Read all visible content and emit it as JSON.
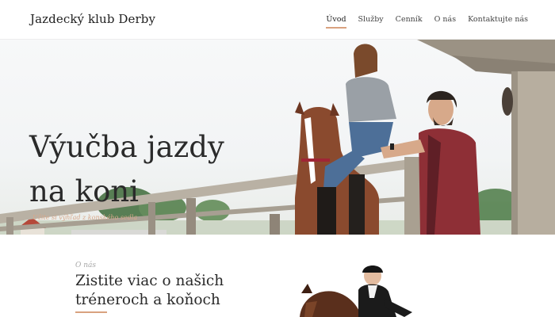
{
  "header": {
    "brand": "Jazdecký klub Derby",
    "nav": [
      {
        "label": "Úvod",
        "active": true
      },
      {
        "label": "Služby",
        "active": false
      },
      {
        "label": "Cenník",
        "active": false
      },
      {
        "label": "O nás",
        "active": false
      },
      {
        "label": "Kontaktujte nás",
        "active": false
      }
    ],
    "accent_color": "#d9a27f"
  },
  "hero": {
    "title_line1": "Výučba jazdy",
    "title_line2": "na koni",
    "subtitle": "Užite si výhľad z konského sedla"
  },
  "about": {
    "kicker": "O nás",
    "title_line1": "Zistite viac o našich",
    "title_line2": "tréneroch a koňoch"
  }
}
